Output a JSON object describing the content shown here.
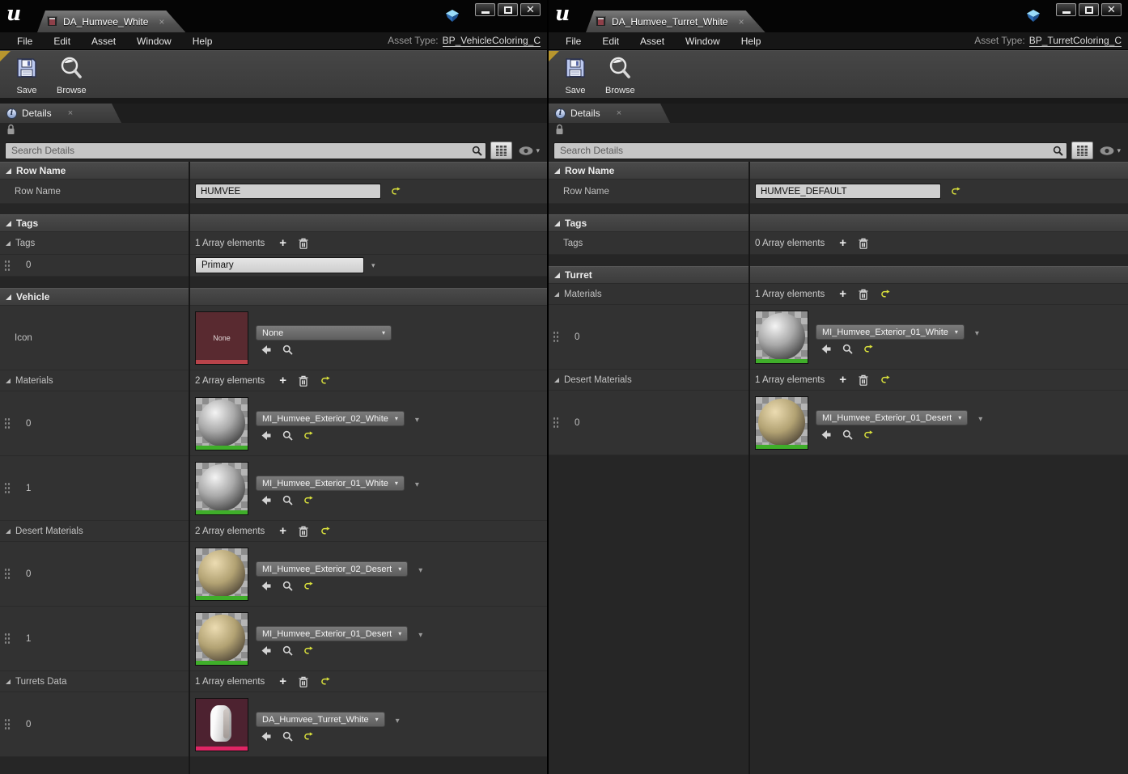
{
  "left": {
    "tab_title": "DA_Humvee_White",
    "menu": [
      "File",
      "Edit",
      "Asset",
      "Window",
      "Help"
    ],
    "asset_type_label": "Asset Type:",
    "asset_type": "BP_VehicleColoring_C",
    "toolbar": {
      "save": "Save",
      "browse": "Browse"
    },
    "details_tab": "Details",
    "search_placeholder": "Search Details",
    "row_name": {
      "header": "Row Name",
      "label": "Row Name",
      "value": "HUMVEE"
    },
    "tags": {
      "header": "Tags",
      "label": "Tags",
      "count": "1 Array elements",
      "items": [
        {
          "index": "0",
          "value": "Primary"
        }
      ]
    },
    "vehicle": {
      "header": "Vehicle",
      "icon_label": "Icon",
      "icon_thumb": "None",
      "icon_value": "None",
      "materials": {
        "label": "Materials",
        "count": "2 Array elements",
        "items": [
          {
            "index": "0",
            "value": "MI_Humvee_Exterior_02_White"
          },
          {
            "index": "1",
            "value": "MI_Humvee_Exterior_01_White"
          }
        ]
      },
      "desert_materials": {
        "label": "Desert Materials",
        "count": "2 Array elements",
        "items": [
          {
            "index": "0",
            "value": "MI_Humvee_Exterior_02_Desert"
          },
          {
            "index": "1",
            "value": "MI_Humvee_Exterior_01_Desert"
          }
        ]
      },
      "turrets_data": {
        "label": "Turrets Data",
        "count": "1 Array elements",
        "items": [
          {
            "index": "0",
            "value": "DA_Humvee_Turret_White"
          }
        ]
      }
    }
  },
  "right": {
    "tab_title": "DA_Humvee_Turret_White",
    "menu": [
      "File",
      "Edit",
      "Asset",
      "Window",
      "Help"
    ],
    "asset_type_label": "Asset Type:",
    "asset_type": "BP_TurretColoring_C",
    "toolbar": {
      "save": "Save",
      "browse": "Browse"
    },
    "details_tab": "Details",
    "search_placeholder": "Search Details",
    "row_name": {
      "header": "Row Name",
      "label": "Row Name",
      "value": "HUMVEE_DEFAULT"
    },
    "tags": {
      "header": "Tags",
      "label": "Tags",
      "count": "0 Array elements"
    },
    "turret": {
      "header": "Turret",
      "materials": {
        "label": "Materials",
        "count": "1 Array elements",
        "items": [
          {
            "index": "0",
            "value": "MI_Humvee_Exterior_01_White"
          }
        ]
      },
      "desert_materials": {
        "label": "Desert Materials",
        "count": "1 Array elements",
        "items": [
          {
            "index": "0",
            "value": "MI_Humvee_Exterior_01_Desert"
          }
        ]
      }
    }
  },
  "colors": {
    "thumbnail_bar_green": "#3fae2a",
    "thumbnail_bar_red": "#b8434a",
    "thumbnail_bar_pink": "#e02565",
    "reset_icon_yellow": "#d9e03c",
    "icon_thumb_bg": "#592a30",
    "turret_thumb_bg": "#4d2230"
  }
}
